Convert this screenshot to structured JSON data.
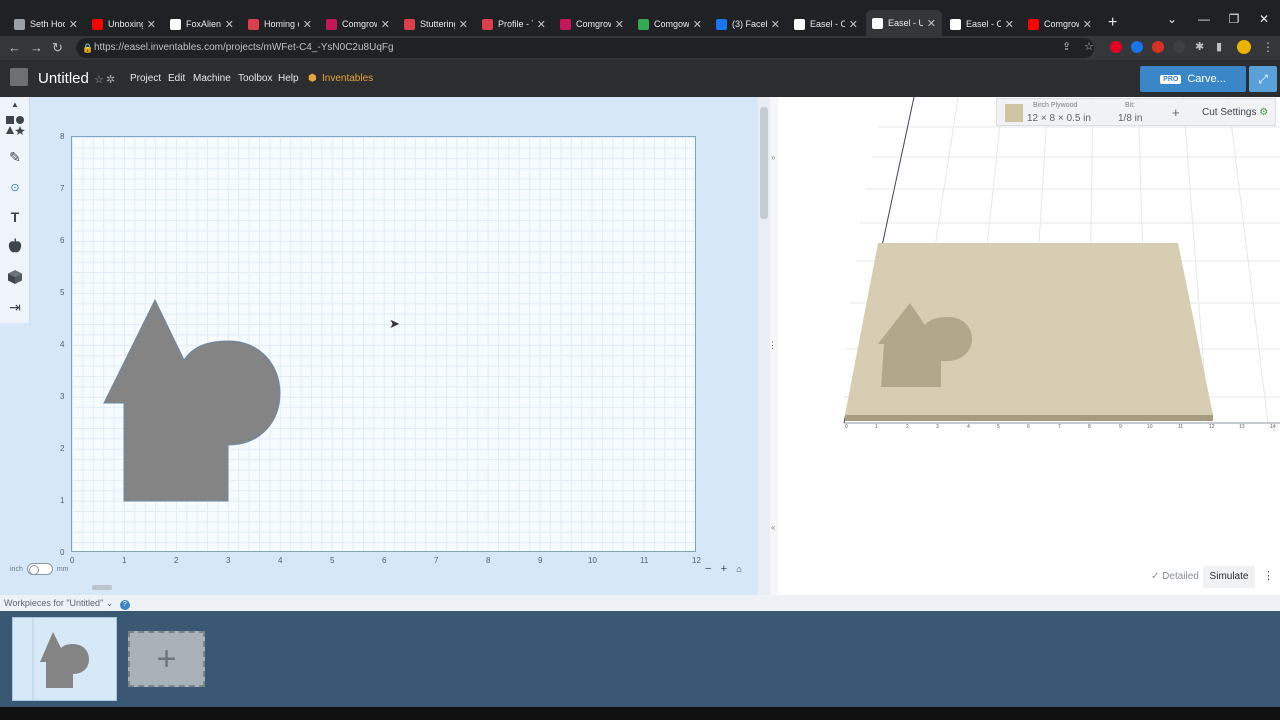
{
  "browser": {
    "tabs": [
      {
        "title": "Seth Hoo",
        "color": "#9aa0a6"
      },
      {
        "title": "Unboxing",
        "color": "#ff0000"
      },
      {
        "title": "FoxAlien",
        "color": "#ffffff"
      },
      {
        "title": "Homing o",
        "color": "#d93f4c"
      },
      {
        "title": "Comgrow",
        "color": "#c2185b"
      },
      {
        "title": "Stuttering",
        "color": "#d93f4c"
      },
      {
        "title": "Profile - T",
        "color": "#d93f4c"
      },
      {
        "title": "Comgrow",
        "color": "#c2185b"
      },
      {
        "title": "Comgow",
        "color": "#34a853"
      },
      {
        "title": "(3) Facebo",
        "color": "#1877f2"
      },
      {
        "title": "Easel - Ca",
        "color": "#ffffff"
      },
      {
        "title": "Easel - Un",
        "color": "#ffffff"
      },
      {
        "title": "Easel - Co",
        "color": "#ffffff"
      },
      {
        "title": "Comgrow",
        "color": "#ff0000"
      }
    ],
    "url": "https://easel.inventables.com/projects/mWFet-C4_-YsN0C2u8UqFg"
  },
  "app": {
    "title": "Untitled",
    "menu": [
      "Project",
      "Edit",
      "Machine",
      "Toolbox",
      "Help"
    ],
    "inventables": "Inventables",
    "pro_badge": "PRO",
    "carve_label": "Carve..."
  },
  "tools": [
    {
      "name": "shapes-icon",
      "glyph": "■"
    },
    {
      "name": "pen-icon",
      "glyph": "✎"
    },
    {
      "name": "target-icon",
      "glyph": "⊙"
    },
    {
      "name": "text-icon",
      "glyph": "T"
    },
    {
      "name": "apple-icon",
      "glyph": "●"
    },
    {
      "name": "cube-icon",
      "glyph": "▰"
    },
    {
      "name": "import-icon",
      "glyph": "⇥"
    }
  ],
  "canvas": {
    "y_ticks": [
      "8",
      "7",
      "6",
      "5",
      "4",
      "3",
      "2",
      "1",
      "0"
    ],
    "x_ticks": [
      "0",
      "1",
      "2",
      "3",
      "4",
      "5",
      "6",
      "7",
      "8",
      "9",
      "10",
      "11",
      "12"
    ],
    "unit_inch": "inch",
    "unit_mm": "mm"
  },
  "material": {
    "name": "Birch Plywood",
    "dims": "12 × 8 × 0.5 in",
    "bit_label": "Bit:",
    "bit_size": "1/8 in",
    "cut_settings": "Cut Settings"
  },
  "preview": {
    "axis_ticks": [
      "0",
      "1",
      "2",
      "3",
      "4",
      "5",
      "6",
      "7",
      "8",
      "9",
      "10",
      "11",
      "12",
      "13",
      "14"
    ],
    "detailed": "Detailed",
    "simulate": "Simulate"
  },
  "workpieces": {
    "header": "Workpieces for \"Untitled\""
  },
  "colors": {
    "shape": "#848484",
    "accent": "#3b86c9",
    "wood": "#d6cdb2"
  }
}
